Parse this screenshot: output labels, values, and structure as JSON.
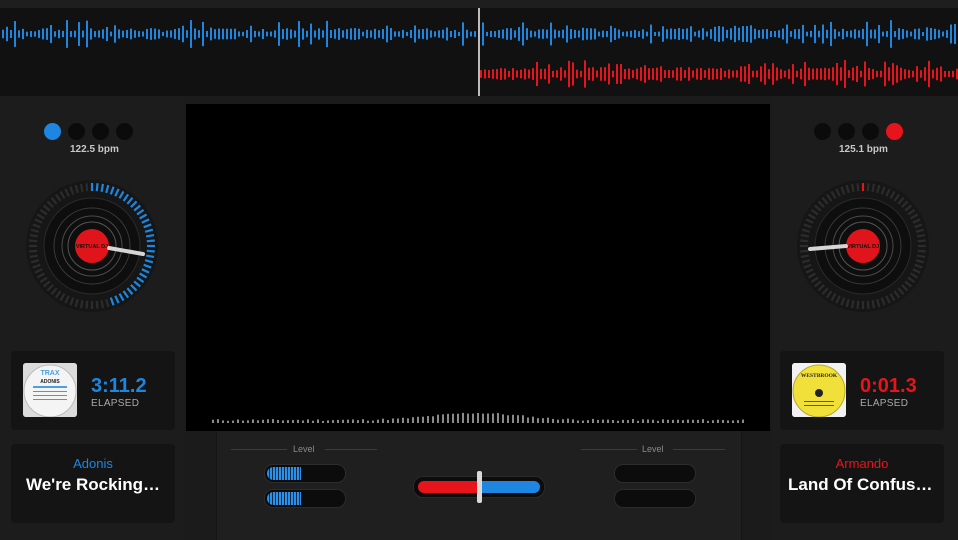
{
  "colors": {
    "deck_left_accent": "#1e86e0",
    "deck_right_accent": "#e8141b",
    "background": "#1b1b1b",
    "panel": "#141414"
  },
  "deck_left": {
    "bpm": "122.5 bpm",
    "time": "3:11.2",
    "time_label": "ELAPSED",
    "artist": "Adonis",
    "title": "We're Rocking…",
    "active_dot": 0,
    "album_art": "trax-records-vinyl",
    "album_text_brand": "TRAX",
    "album_text_artist": "ADONIS",
    "level_label": "Level",
    "meter_levels": [
      0.45,
      0.45
    ],
    "platter_label": "VIRTUAL DJ",
    "ring_progress": 0.45
  },
  "deck_right": {
    "bpm": "125.1 bpm",
    "time": "0:01.3",
    "time_label": "ELAPSED",
    "artist": "Armando",
    "title": "Land Of Confusi…",
    "active_dot": 3,
    "album_art": "westbrook-records-vinyl",
    "album_text_brand": "WESTBROOK",
    "level_label": "Level",
    "meter_levels": [
      0,
      0
    ],
    "platter_label": "VIRTUAL DJ",
    "ring_progress": 0.01
  },
  "mixer": {
    "crossfader_position": 0.5
  },
  "icons": {
    "turntable": "turntable-platter-icon",
    "album": "album-cover-icon"
  }
}
